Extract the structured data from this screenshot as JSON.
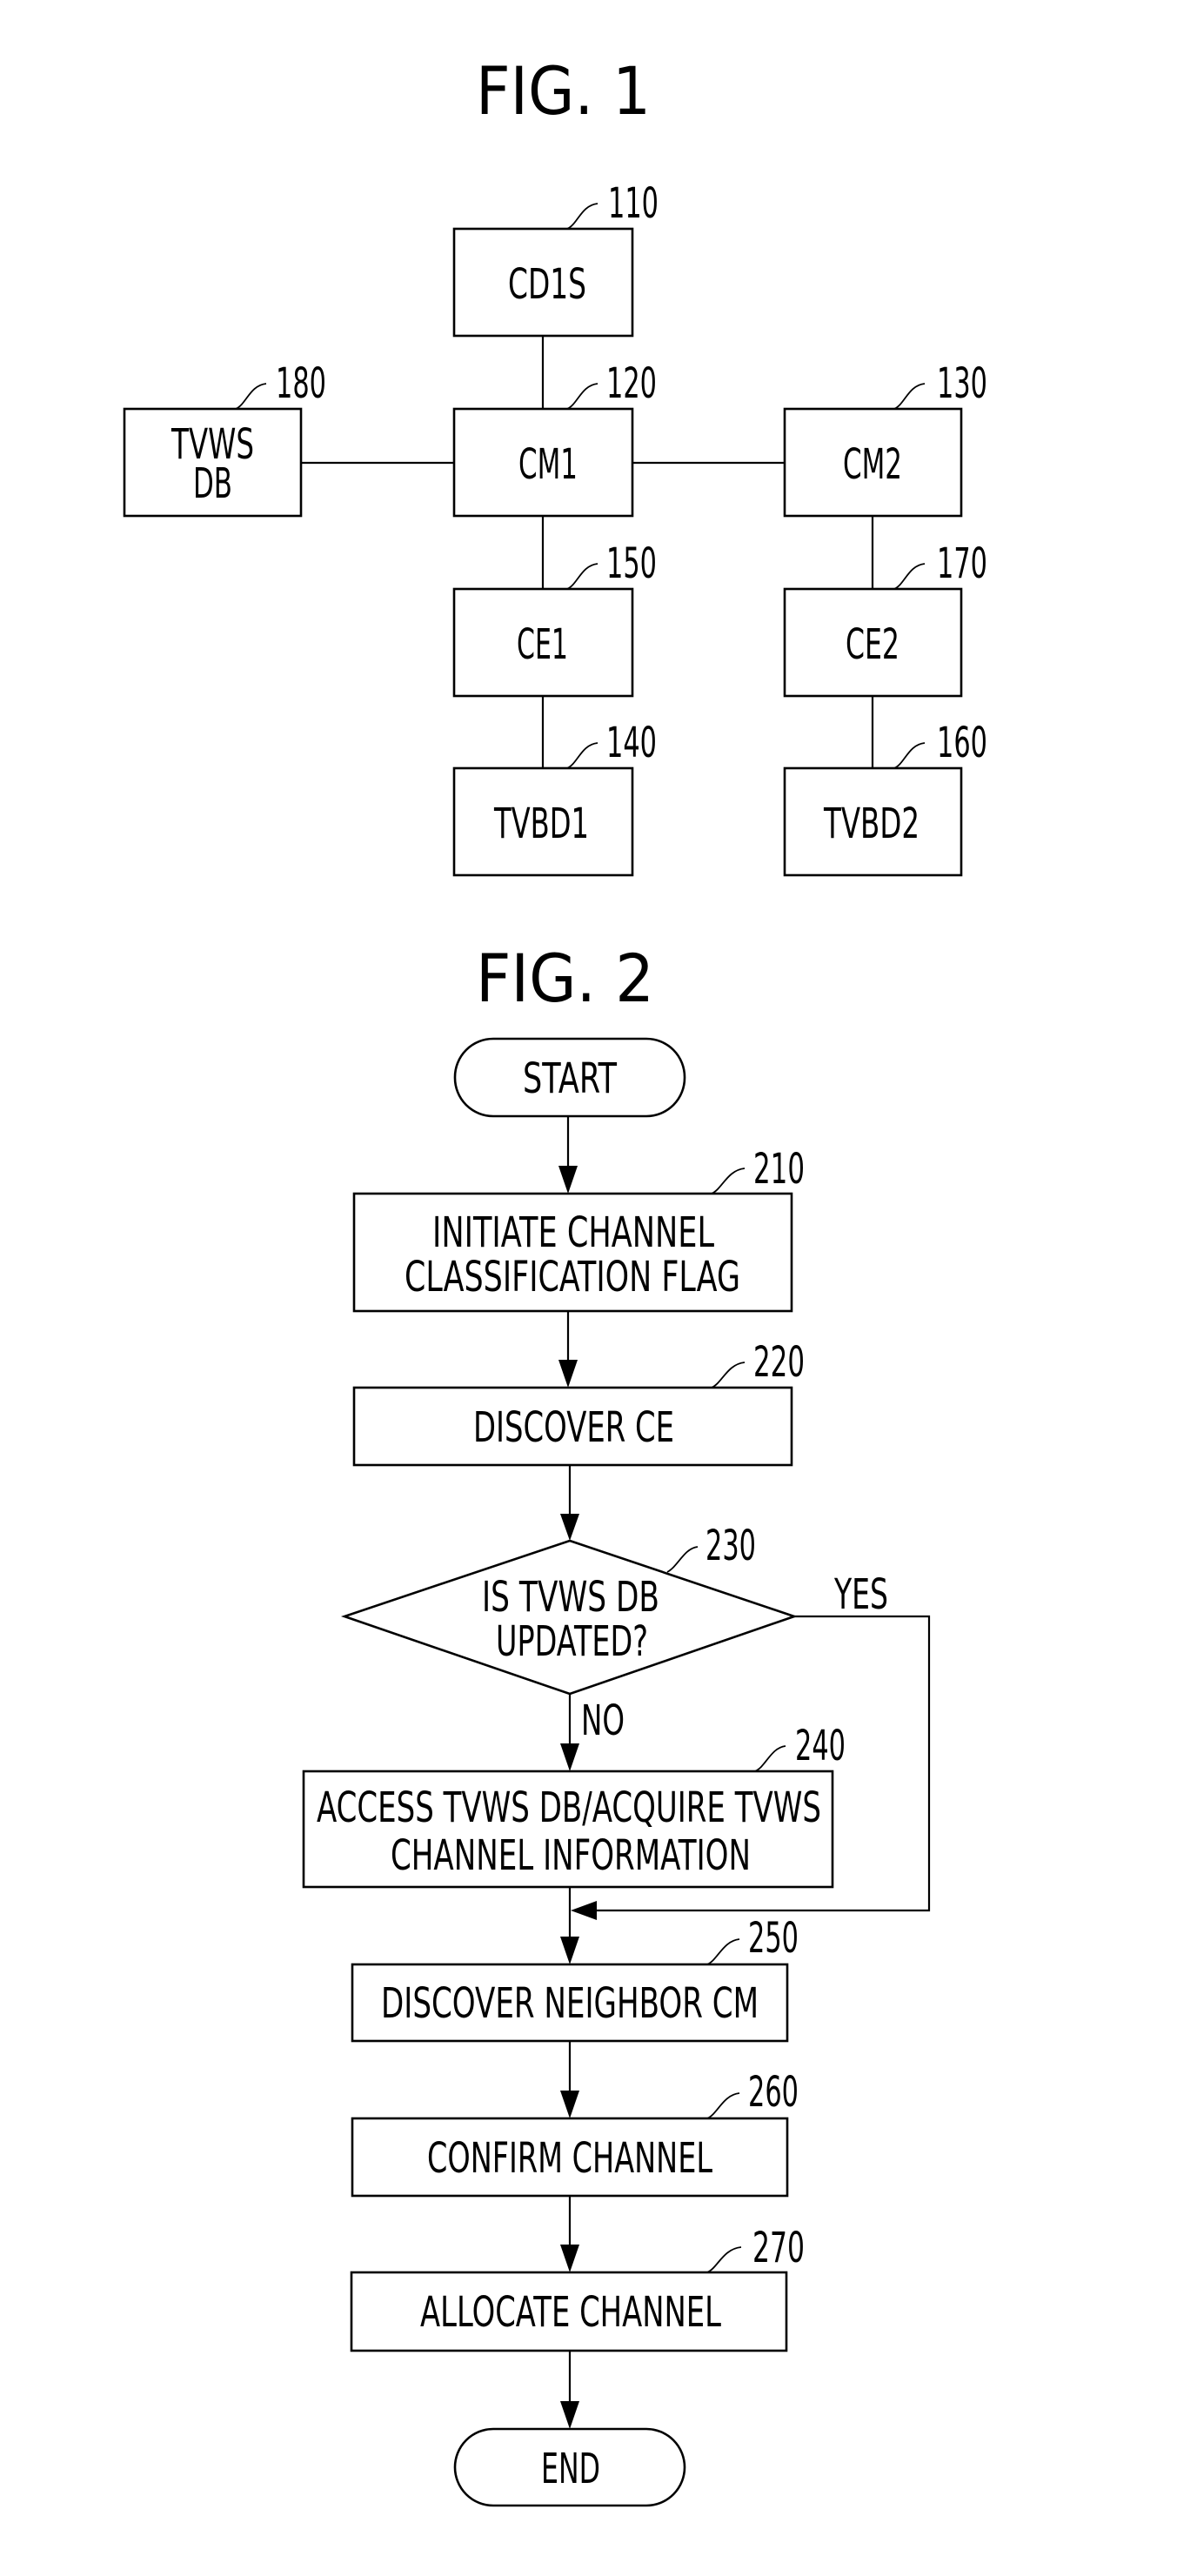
{
  "fig1": {
    "title": "FIG. 1",
    "nodes": {
      "cd1s": {
        "label": "CD1S",
        "ref": "110"
      },
      "tvws_db": {
        "label_line1": "TVWS",
        "label_line2": "DB",
        "ref": "180"
      },
      "cm1": {
        "label": "CM1",
        "ref": "120"
      },
      "cm2": {
        "label": "CM2",
        "ref": "130"
      },
      "ce1": {
        "label": "CE1",
        "ref": "150"
      },
      "ce2": {
        "label": "CE2",
        "ref": "170"
      },
      "tvbd1": {
        "label": "TVBD1",
        "ref": "140"
      },
      "tvbd2": {
        "label": "TVBD2",
        "ref": "160"
      }
    },
    "edges": [
      [
        "CD1S",
        "CM1"
      ],
      [
        "TVWS DB",
        "CM1"
      ],
      [
        "CM1",
        "CM2"
      ],
      [
        "CM1",
        "CE1"
      ],
      [
        "CE1",
        "TVBD1"
      ],
      [
        "CM2",
        "CE2"
      ],
      [
        "CE2",
        "TVBD2"
      ]
    ]
  },
  "fig2": {
    "title": "FIG. 2",
    "start": "START",
    "end": "END",
    "steps": {
      "s210": {
        "line1": "INITIATE CHANNEL",
        "line2": "CLASSIFICATION FLAG",
        "ref": "210"
      },
      "s220": {
        "label": "DISCOVER CE",
        "ref": "220"
      },
      "s230": {
        "line1": "IS TVWS DB",
        "line2": "UPDATED?",
        "ref": "230"
      },
      "s240": {
        "line1": "ACCESS TVWS DB/ACQUIRE TVWS",
        "line2": "CHANNEL INFORMATION",
        "ref": "240"
      },
      "s250": {
        "label": "DISCOVER NEIGHBOR CM",
        "ref": "250"
      },
      "s260": {
        "label": "CONFIRM CHANNEL",
        "ref": "260"
      },
      "s270": {
        "label": "ALLOCATE CHANNEL",
        "ref": "270"
      }
    },
    "branches": {
      "yes": "YES",
      "no": "NO"
    }
  }
}
